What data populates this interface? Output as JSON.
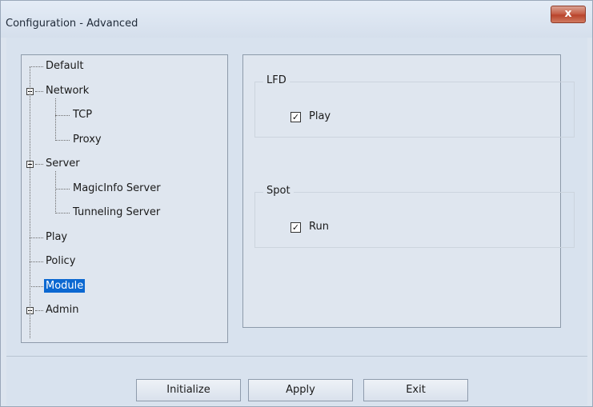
{
  "window": {
    "title": "Configuration - Advanced",
    "close_label": "x"
  },
  "tree": {
    "items": [
      {
        "label": "Default",
        "level": 1,
        "expandable": false,
        "selected": false
      },
      {
        "label": "Network",
        "level": 0,
        "expandable": true,
        "selected": false
      },
      {
        "label": "TCP",
        "level": 2,
        "expandable": false,
        "selected": false
      },
      {
        "label": "Proxy",
        "level": 2,
        "expandable": false,
        "selected": false
      },
      {
        "label": "Server",
        "level": 0,
        "expandable": true,
        "selected": false
      },
      {
        "label": "MagicInfo Server",
        "level": 2,
        "expandable": false,
        "selected": false
      },
      {
        "label": "Tunneling Server",
        "level": 2,
        "expandable": false,
        "selected": false
      },
      {
        "label": "Play",
        "level": 1,
        "expandable": false,
        "selected": false
      },
      {
        "label": "Policy",
        "level": 1,
        "expandable": false,
        "selected": false
      },
      {
        "label": "Module",
        "level": 1,
        "expandable": false,
        "selected": true
      },
      {
        "label": "Admin",
        "level": 0,
        "expandable": true,
        "selected": false
      }
    ],
    "scroll_up": "^",
    "scroll_down": "v"
  },
  "settings": {
    "groups": [
      {
        "title": "LFD",
        "option_label": "Play",
        "checked": true
      },
      {
        "title": "Spot",
        "option_label": "Run",
        "checked": true
      }
    ]
  },
  "buttons": {
    "initialize": "Initialize",
    "apply": "Apply",
    "exit": "Exit"
  }
}
